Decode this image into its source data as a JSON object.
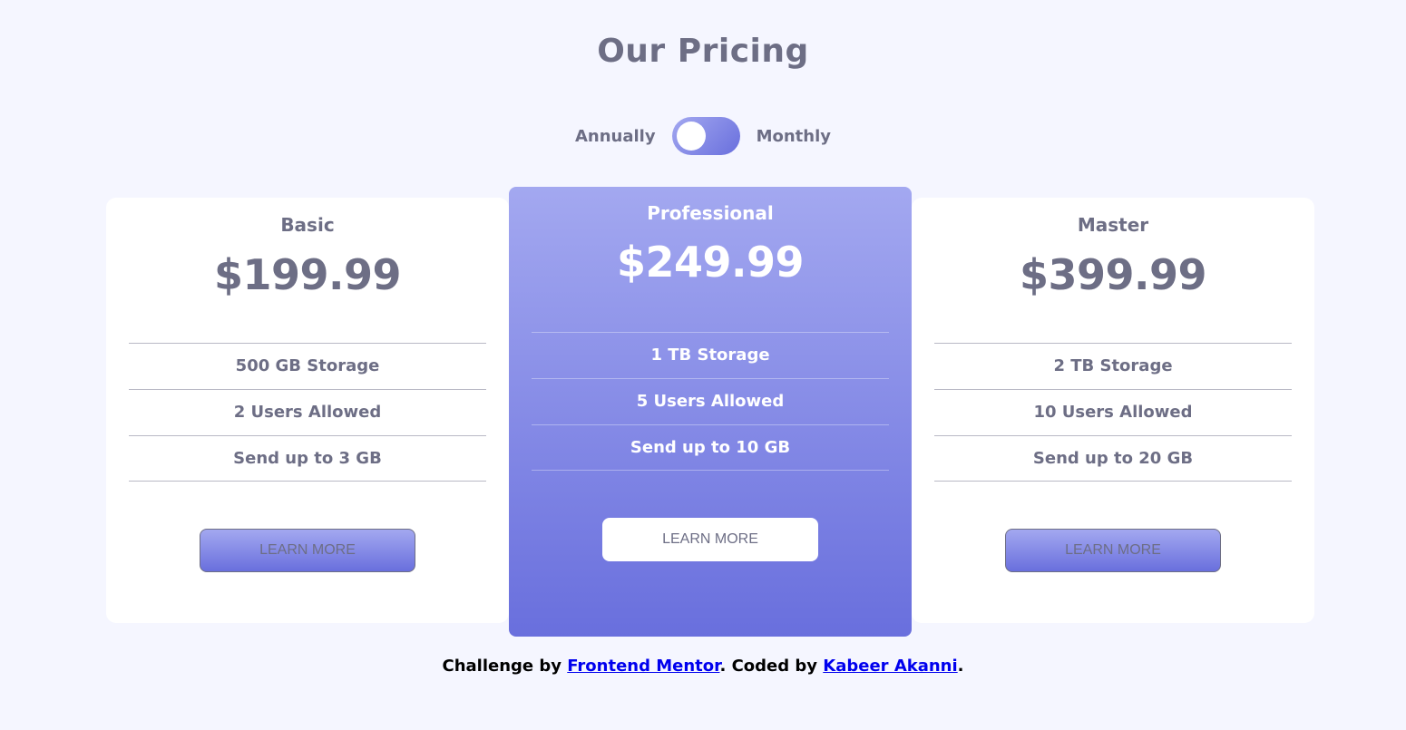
{
  "header": {
    "title": "Our Pricing"
  },
  "billing_toggle": {
    "left_label": "Annually",
    "right_label": "Monthly"
  },
  "plans": [
    {
      "name": "Basic",
      "price": "$199.99",
      "features": [
        "500 GB Storage",
        "2 Users Allowed",
        "Send up to 3 GB"
      ],
      "button_label": "LEARN MORE"
    },
    {
      "name": "Professional",
      "price": "$249.99",
      "features": [
        "1 TB Storage",
        "5 Users Allowed",
        "Send up to 10 GB"
      ],
      "button_label": "LEARN MORE"
    },
    {
      "name": "Master",
      "price": "$399.99",
      "features": [
        "2 TB Storage",
        "10 Users Allowed",
        "Send up to 20 GB"
      ],
      "button_label": "LEARN MORE"
    }
  ],
  "footer": {
    "prefix": "Challenge by ",
    "link1": "Frontend Mentor",
    "middle": ". Coded by ",
    "link2": "Kabeer Akanni",
    "suffix": "."
  },
  "colors": {
    "accent_start": "#a3a8f0",
    "accent_end": "#696fdd",
    "text": "#6d6e85",
    "background": "#f5f6ff"
  }
}
